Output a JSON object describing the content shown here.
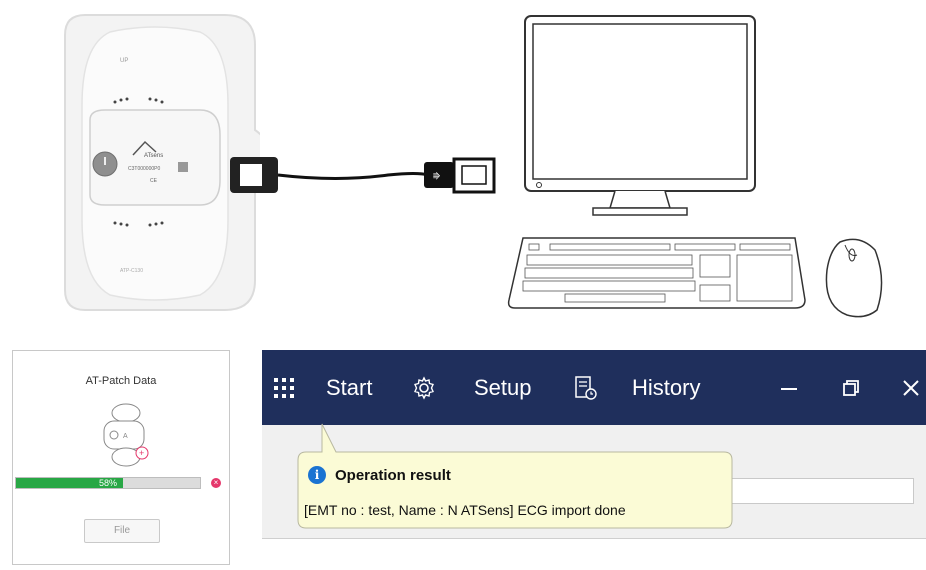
{
  "device": {
    "top_mark": "UP",
    "brand": "ATsens",
    "serial": "C3T000000P0",
    "cert": "CE",
    "bottom_label": "ATP-C130"
  },
  "patch_panel": {
    "title": "AT-Patch Data",
    "progress_percent": 58,
    "progress_label": "58%",
    "file_button": "File",
    "device_logo_text": "A"
  },
  "app": {
    "toolbar": {
      "start_label": "Start",
      "setup_label": "Setup",
      "history_label": "History"
    },
    "title_bar_color": "#1f2f5c",
    "tooltip": {
      "title": "Operation result",
      "message": "[EMT no : test, Name : N ATSens] ECG import done"
    }
  },
  "colors": {
    "accent_green": "#28a745",
    "cancel_pink": "#e5376b",
    "info_blue": "#1a73d2",
    "tooltip_bg": "#fbfbd6"
  }
}
